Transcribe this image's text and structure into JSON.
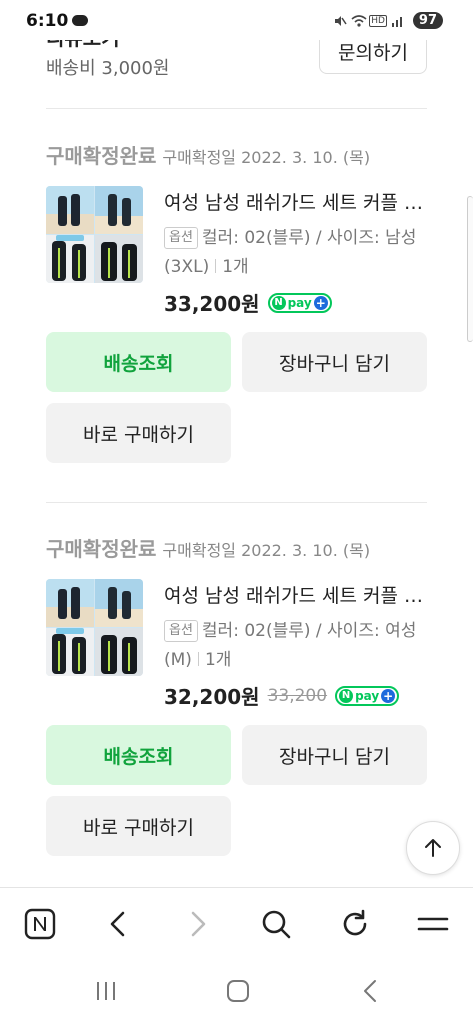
{
  "status_bar": {
    "time": "6:10",
    "battery": "97"
  },
  "top_section": {
    "title_partial": "리뷰보기",
    "shipping_fee": "배송비 3,000원",
    "inquiry_button": "문의하기"
  },
  "orders": [
    {
      "status": "구매확정완료",
      "confirmed_date": "구매확정일 2022. 3. 10. (목)",
      "product_name": "여성 남성 래쉬가드 세트 커플 수영복",
      "option_badge": "옵션",
      "option_text": "컬러: 02(블루) / 사이즈: 남성(3XL)",
      "quantity": "1개",
      "price": "33,200원",
      "original_price": "",
      "npay_label": "pay",
      "buttons": {
        "track": "배송조회",
        "cart": "장바구니 담기",
        "buy_now": "바로 구매하기"
      }
    },
    {
      "status": "구매확정완료",
      "confirmed_date": "구매확정일 2022. 3. 10. (목)",
      "product_name": "여성 남성 래쉬가드 세트 커플 수영복",
      "option_badge": "옵션",
      "option_text": "컬러: 02(블루) / 사이즈: 여성(M)",
      "quantity": "1개",
      "price": "32,200원",
      "original_price": "33,200",
      "npay_label": "pay",
      "buttons": {
        "track": "배송조회",
        "cart": "장바구니 담기",
        "buy_now": "바로 구매하기"
      }
    }
  ],
  "toolbar": {
    "icons": [
      "naver-home-icon",
      "back-icon",
      "forward-icon",
      "search-icon",
      "refresh-icon",
      "menu-icon"
    ]
  },
  "nav_bar": {
    "icons": [
      "recent-apps-icon",
      "home-icon",
      "back-icon"
    ]
  },
  "colors": {
    "accent_green": "#03c75a",
    "button_green_bg": "#d9f8df",
    "button_green_text": "#11a33d",
    "npay_plus_blue": "#1e6bdc"
  }
}
